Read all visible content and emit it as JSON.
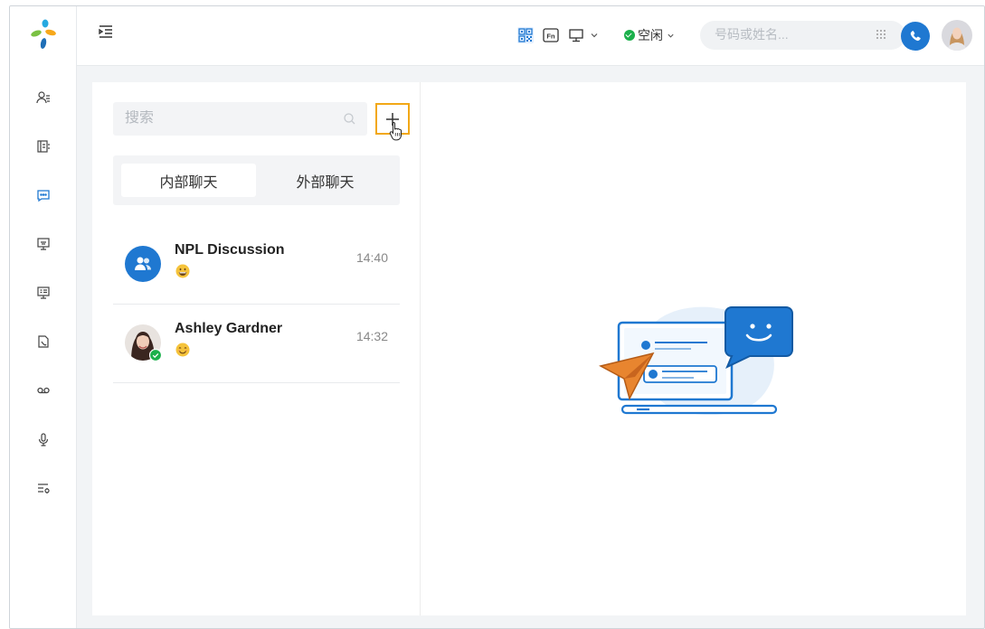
{
  "topbar": {
    "status_label": "空闲",
    "dial_placeholder": "号码或姓名..."
  },
  "search": {
    "placeholder": "搜索"
  },
  "tabs": [
    {
      "label": "内部聊天",
      "active": true
    },
    {
      "label": "外部聊天",
      "active": false
    }
  ],
  "chats": [
    {
      "name": "NPL Discussion",
      "time": "14:40",
      "type": "group",
      "emoji": "grinning-face"
    },
    {
      "name": "Ashley Gardner",
      "time": "14:32",
      "type": "user",
      "emoji": "smiling-face",
      "online": true
    }
  ],
  "colors": {
    "accent": "#1f78d1",
    "highlight": "#f2a817",
    "online": "#1bb04b"
  }
}
